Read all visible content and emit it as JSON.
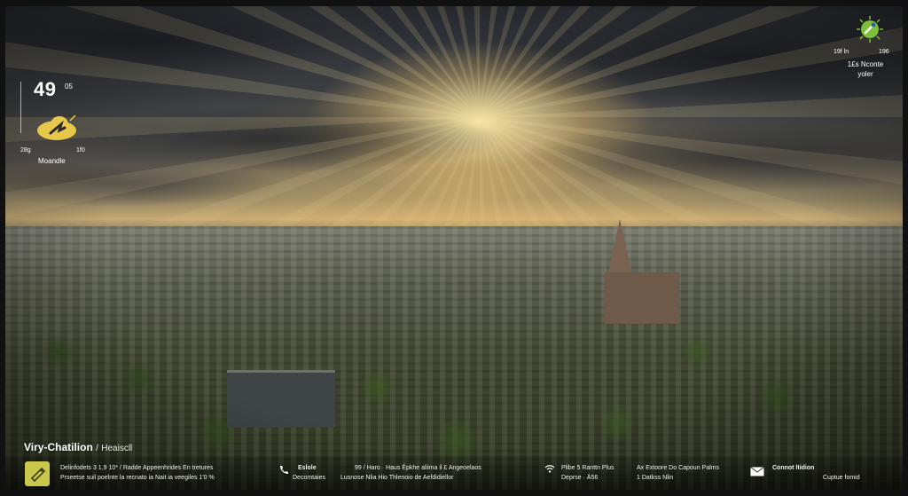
{
  "weather": {
    "temperature": "49",
    "temperature_sup": "05",
    "low": "28g",
    "high": "1f0",
    "location": "Moandle",
    "icon": "partly-cloudy-icon",
    "icon_color": "#e7c84b"
  },
  "sun_widget": {
    "icon": "sun-compass-icon",
    "icon_color": "#7fbf3a",
    "low": "19f ln",
    "high": "196",
    "line1": "1£s Nconte",
    "line2": "yoler"
  },
  "city": {
    "name": "Viry-Chatilion",
    "separator": "/",
    "suffix": "Heaiscll"
  },
  "info_bar": {
    "icon_color": "#c9c84a",
    "col1": {
      "line1": "Delinfodets 3 1,9 10* / Radde Appeenhrides En tretures",
      "line2": "Prseetse suil poelnte la recnato ia Nait ia veegiles 1'0 %"
    },
    "col2": {
      "icon": "phone-icon",
      "title": "Eslole",
      "subtitle": "Decomtaies"
    },
    "col3": {
      "line1": "99 / Haro · Haus  Épkhe aliima il £  Angeoelaos",
      "line2": "Lusnose   Nlia  Hio  Thlenoio de  Aefdidiellor"
    },
    "col4": {
      "icon": "wifi-icon",
      "line1": "Plibe 5 Ranttn Plus",
      "line2": "Deprse   ·   Ä56"
    },
    "col5": {
      "line1": "Ax Extoore Do Capoun Palms",
      "line2": "1 Datkss   Nlin"
    },
    "col6": {
      "icon": "mail-icon",
      "line1": "Connot ltidion",
      "line2": "Cuptue fomid"
    }
  }
}
